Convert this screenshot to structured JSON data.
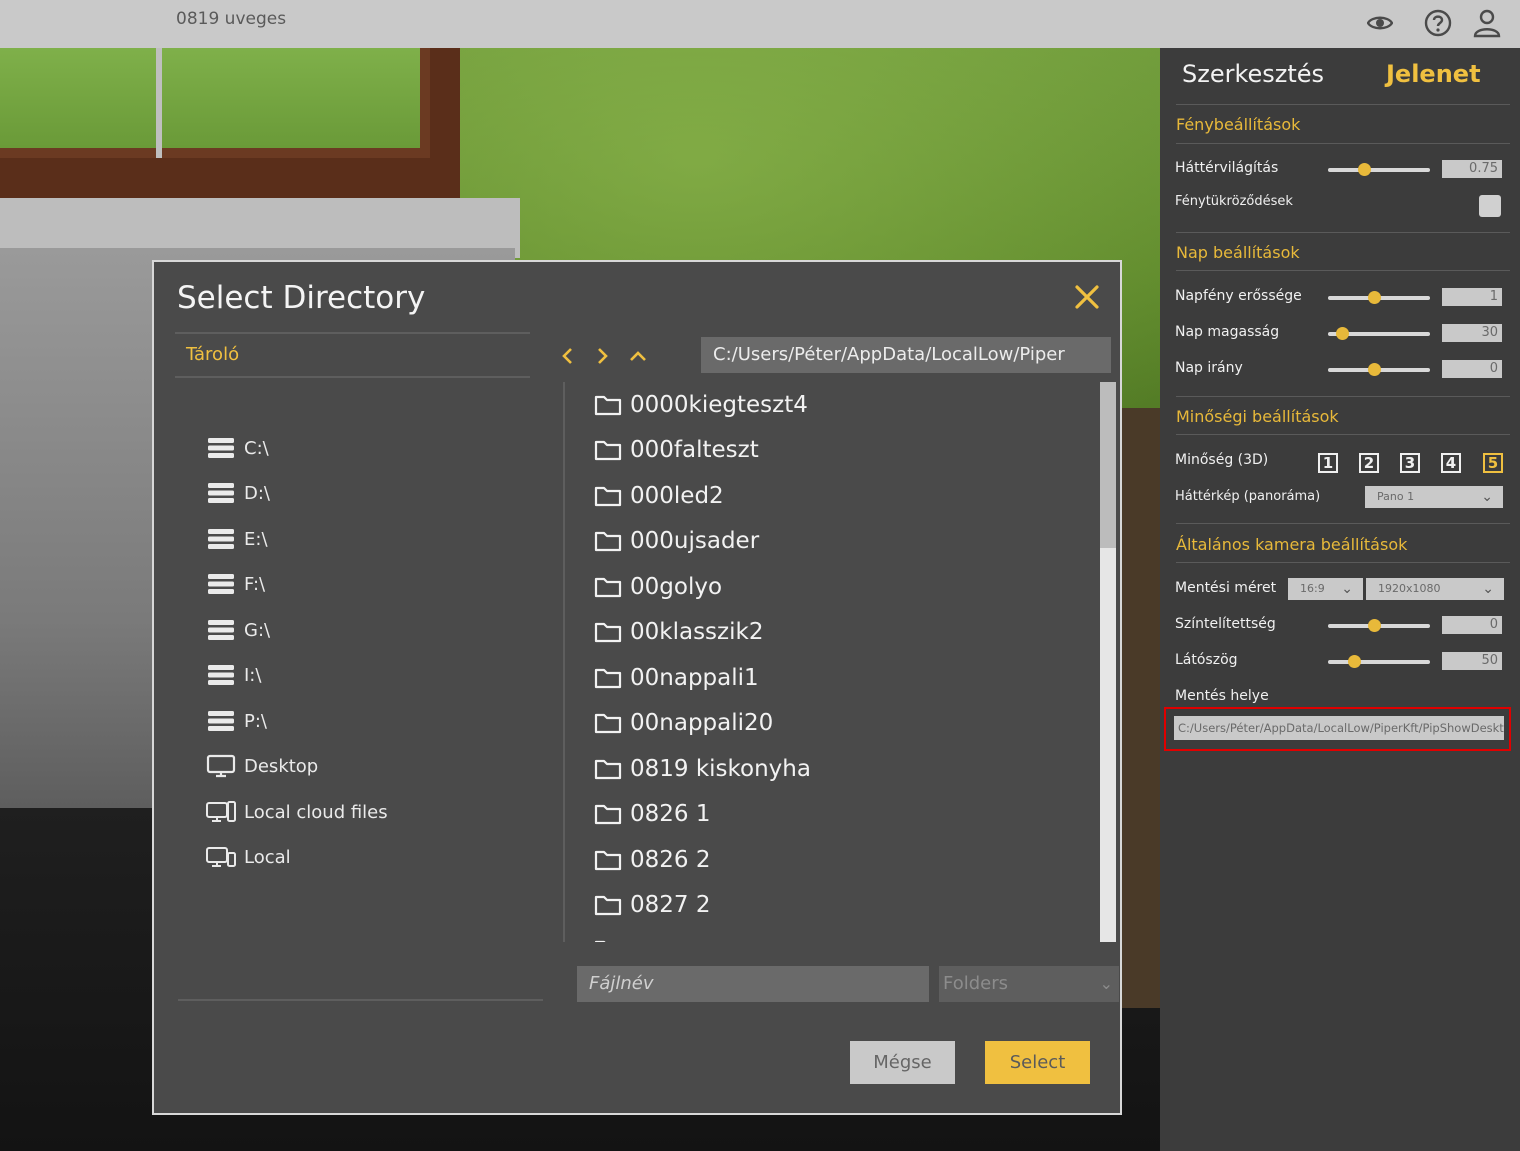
{
  "topbar": {
    "title": "0819 uveges",
    "icons": [
      "eye-icon",
      "help-icon",
      "user-icon"
    ]
  },
  "panel": {
    "tabs": {
      "edit": "Szerkesztés",
      "scene": "Jelenet"
    },
    "light": {
      "heading": "Fénybeállítások",
      "ambient_label": "Háttérvilágítás",
      "ambient_value": "0.75",
      "ambient_level": 0.35,
      "reflections_label": "Fénytükröződések"
    },
    "sun": {
      "heading": "Nap beállítások",
      "intensity_label": "Napfény erőssége",
      "intensity_value": "1",
      "intensity_level": 0.45,
      "height_label": "Nap magasság",
      "height_value": "30",
      "height_level": 0.14,
      "direction_label": "Nap irány",
      "direction_value": "0",
      "direction_level": 0.45
    },
    "quality": {
      "heading": "Minőségi beállítások",
      "quality_label": "Minőség (3D)",
      "levels": [
        "1",
        "2",
        "3",
        "4",
        "5"
      ],
      "active_level": "5",
      "background_label": "Háttérkép (panoráma)",
      "background_value": "Pano 1"
    },
    "camera": {
      "heading": "Általános kamera beállítások",
      "save_size_label": "Mentési méret",
      "aspect_value": "16:9",
      "resolution_value": "1920x1080",
      "saturation_label": "Színtelítettség",
      "saturation_value": "0",
      "saturation_level": 0.45,
      "fov_label": "Látószög",
      "fov_value": "50",
      "fov_level": 0.25,
      "save_location_label": "Mentés helye",
      "save_location_value": "C:/Users/Péter/AppData/LocalLow/PiperKft/PipShowDesktop"
    }
  },
  "dialog": {
    "title": "Select Directory",
    "storage_label": "Tároló",
    "drives": [
      {
        "label": "C:\\",
        "icon": "drive-icon"
      },
      {
        "label": "D:\\",
        "icon": "drive-icon"
      },
      {
        "label": "E:\\",
        "icon": "drive-icon"
      },
      {
        "label": "F:\\",
        "icon": "drive-icon"
      },
      {
        "label": "G:\\",
        "icon": "drive-icon"
      },
      {
        "label": "I:\\",
        "icon": "drive-icon"
      },
      {
        "label": "P:\\",
        "icon": "drive-icon"
      },
      {
        "label": "Desktop",
        "icon": "monitor-icon"
      },
      {
        "label": "Local cloud files",
        "icon": "devices-icon"
      },
      {
        "label": "Local",
        "icon": "devices-icon"
      }
    ],
    "path": "C:/Users/Péter/AppData/LocalLow/Piper",
    "folders": [
      "0000kiegteszt4",
      "000falteszt",
      "000led2",
      "000ujsader",
      "00golyo",
      "00klasszik2",
      "00nappali1",
      "00nappali20",
      "0819 kiskonyha",
      "0826 1",
      "0826 2",
      "0827 2"
    ],
    "filename_placeholder": "Fájlnév",
    "filetype_value": "Folders",
    "cancel_label": "Mégse",
    "select_label": "Select"
  }
}
